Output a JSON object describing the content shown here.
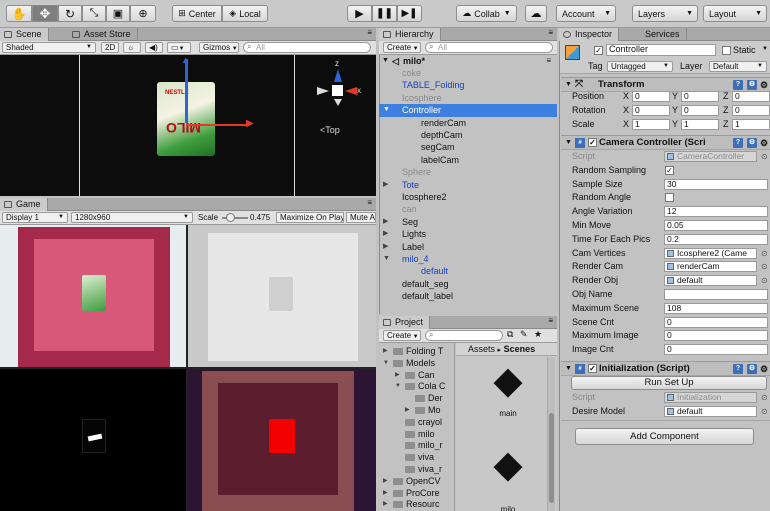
{
  "toolbar": {
    "center": "Center",
    "local": "Local",
    "collab": "Collab",
    "account": "Account",
    "layers": "Layers",
    "layout": "Layout"
  },
  "scene": {
    "tab": "Scene",
    "tab2": "Asset Store",
    "shaded": "Shaded",
    "twoD": "2D",
    "gizmos": "Gizmos",
    "search": "All",
    "view_label": "Top",
    "gizmo_axis_z": "z",
    "gizmo_axis_x": "x",
    "product_text": "MILO",
    "product_brand": "NESTLÉ"
  },
  "game": {
    "tab": "Game",
    "display": "Display 1",
    "resolution": "1280x960",
    "scale_label": "Scale",
    "scale_value": "0.475",
    "maximize": "Maximize On Play",
    "mute": "Mute Au",
    "scale_fraction": 0.3
  },
  "hierarchy": {
    "tab": "Hierarchy",
    "create": "Create",
    "search": "All",
    "scene_name": "milo*",
    "rows": [
      {
        "label": "coke",
        "indent": 1,
        "color": "dis",
        "arrow": ""
      },
      {
        "label": "TABLE_Folding",
        "indent": 1,
        "color": "blue",
        "arrow": ""
      },
      {
        "label": "Icosphere",
        "indent": 1,
        "color": "dis",
        "arrow": ""
      },
      {
        "label": "Controller",
        "indent": 1,
        "color": "sel",
        "arrow": "down"
      },
      {
        "label": "renderCam",
        "indent": 2,
        "color": "",
        "arrow": ""
      },
      {
        "label": "depthCam",
        "indent": 2,
        "color": "",
        "arrow": ""
      },
      {
        "label": "segCam",
        "indent": 2,
        "color": "",
        "arrow": ""
      },
      {
        "label": "labelCam",
        "indent": 2,
        "color": "",
        "arrow": ""
      },
      {
        "label": "Sphere",
        "indent": 1,
        "color": "dis",
        "arrow": ""
      },
      {
        "label": "Tote",
        "indent": 1,
        "color": "blue",
        "arrow": "right"
      },
      {
        "label": "Icosphere2",
        "indent": 1,
        "color": "",
        "arrow": ""
      },
      {
        "label": "can",
        "indent": 1,
        "color": "dis",
        "arrow": ""
      },
      {
        "label": "Seg",
        "indent": 1,
        "color": "",
        "arrow": "right"
      },
      {
        "label": "Lights",
        "indent": 1,
        "color": "",
        "arrow": "right"
      },
      {
        "label": "Label",
        "indent": 1,
        "color": "",
        "arrow": "right"
      },
      {
        "label": "milo_4",
        "indent": 1,
        "color": "blue",
        "arrow": "down"
      },
      {
        "label": "default",
        "indent": 2,
        "color": "blue",
        "arrow": ""
      },
      {
        "label": "default_seg",
        "indent": 1,
        "color": "",
        "arrow": ""
      },
      {
        "label": "default_label",
        "indent": 1,
        "color": "",
        "arrow": ""
      }
    ]
  },
  "project": {
    "tab": "Project",
    "create": "Create",
    "breadcrumb_assets": "Assets",
    "breadcrumb_sep": "▸",
    "breadcrumb_scenes": "Scenes",
    "tree": [
      {
        "label": "Folding T",
        "indent": 1,
        "arrow": "right"
      },
      {
        "label": "Models",
        "indent": 1,
        "arrow": "down"
      },
      {
        "label": "Can",
        "indent": 2,
        "arrow": "right"
      },
      {
        "label": "Cola C",
        "indent": 2,
        "arrow": "down"
      },
      {
        "label": "Der",
        "indent": 3,
        "arrow": ""
      },
      {
        "label": "Mo",
        "indent": 3,
        "arrow": "right"
      },
      {
        "label": "crayol",
        "indent": 2,
        "arrow": ""
      },
      {
        "label": "milo",
        "indent": 2,
        "arrow": ""
      },
      {
        "label": "milo_r",
        "indent": 2,
        "arrow": ""
      },
      {
        "label": "viva",
        "indent": 2,
        "arrow": ""
      },
      {
        "label": "viva_r",
        "indent": 2,
        "arrow": ""
      },
      {
        "label": "OpenCV",
        "indent": 1,
        "arrow": "right"
      },
      {
        "label": "ProCore",
        "indent": 1,
        "arrow": "right"
      },
      {
        "label": "Resourc",
        "indent": 1,
        "arrow": "right"
      }
    ],
    "assets": [
      {
        "label": "main"
      },
      {
        "label": "milo"
      }
    ]
  },
  "inspector": {
    "tab": "Inspector",
    "tab2": "Services",
    "object_name": "Controller",
    "static": "Static",
    "tag_label": "Tag",
    "tag_value": "Untagged",
    "layer_label": "Layer",
    "layer_value": "Default",
    "transform": {
      "title": "Transform",
      "rows": [
        {
          "label": "Position",
          "x": "0",
          "y": "0",
          "z": "0"
        },
        {
          "label": "Rotation",
          "x": "0",
          "y": "0",
          "z": "0"
        },
        {
          "label": "Scale",
          "x": "1",
          "y": "1",
          "z": "1"
        }
      ]
    },
    "camera_controller": {
      "title": "Camera Controller (Scri",
      "rows": [
        {
          "label": "Script",
          "value": "CameraController",
          "kind": "obj",
          "dim": true
        },
        {
          "label": "Random Sampling",
          "value": "✓",
          "kind": "check"
        },
        {
          "label": "Sample Size",
          "value": "30",
          "kind": "text"
        },
        {
          "label": "Random Angle",
          "value": "",
          "kind": "check"
        },
        {
          "label": "Angle Variation",
          "value": "12",
          "kind": "text"
        },
        {
          "label": "Min Move",
          "value": "0.05",
          "kind": "text"
        },
        {
          "label": "Time For Each Pics",
          "value": "0.2",
          "kind": "text"
        },
        {
          "label": "Cam Vertices",
          "value": "Icosphere2 (Came",
          "kind": "obj"
        },
        {
          "label": "Render Cam",
          "value": "renderCam",
          "kind": "obj"
        },
        {
          "label": "Render Obj",
          "value": "default",
          "kind": "obj"
        },
        {
          "label": "Obj Name",
          "value": "",
          "kind": "text"
        },
        {
          "label": "Maximum Scene",
          "value": "108",
          "kind": "text"
        },
        {
          "label": "Scene Cnt",
          "value": "0",
          "kind": "text"
        },
        {
          "label": "Maximum Image",
          "value": "0",
          "kind": "text"
        },
        {
          "label": "Image Cnt",
          "value": "0",
          "kind": "text"
        }
      ]
    },
    "initialization": {
      "title": "Initialization (Script)",
      "button": "Run Set Up",
      "rows": [
        {
          "label": "Script",
          "value": "Initialization",
          "dim": true
        },
        {
          "label": "Desire Model",
          "value": "default"
        }
      ]
    },
    "add_component": "Add Component"
  },
  "colors": {
    "selection": "#3d80df",
    "link_blue": "#1a3fb8",
    "dim": "#8a8a8a",
    "panel": "#c2c2c2"
  }
}
